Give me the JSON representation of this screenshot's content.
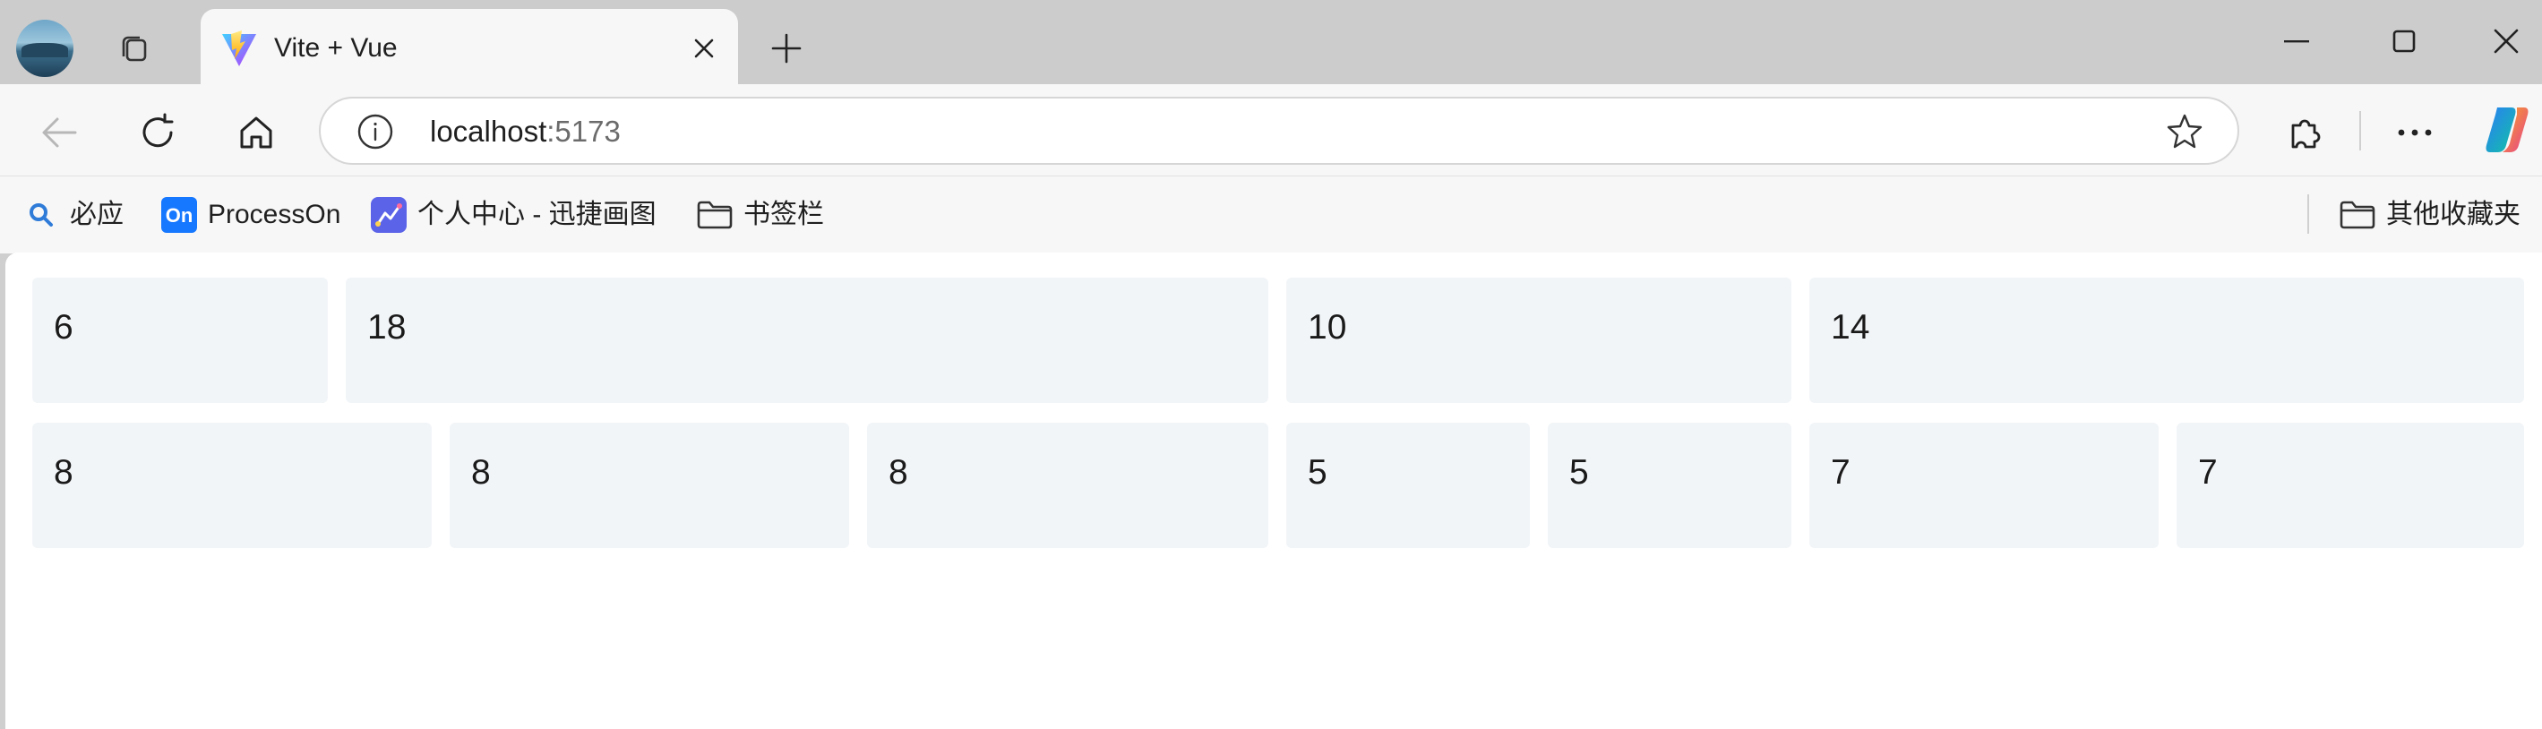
{
  "browser": {
    "tab": {
      "title": "Vite + Vue"
    },
    "address": {
      "host": "localhost",
      "port": ":5173"
    },
    "bookmarks": [
      {
        "label": "必应",
        "icon": "search-icon"
      },
      {
        "label": "ProcessOn",
        "icon": "processon-icon",
        "badge": "On"
      },
      {
        "label": "个人中心 - 迅捷画图",
        "icon": "chart-app-icon"
      },
      {
        "label": "书签栏",
        "icon": "folder-icon"
      }
    ],
    "other_bookmarks": {
      "label": "其他收藏夹",
      "icon": "folder-icon"
    }
  },
  "grid": {
    "rows": [
      [
        "6",
        "18",
        "10",
        "14"
      ],
      [
        "8",
        "8",
        "8",
        "5",
        "5",
        "7",
        "7"
      ]
    ]
  }
}
